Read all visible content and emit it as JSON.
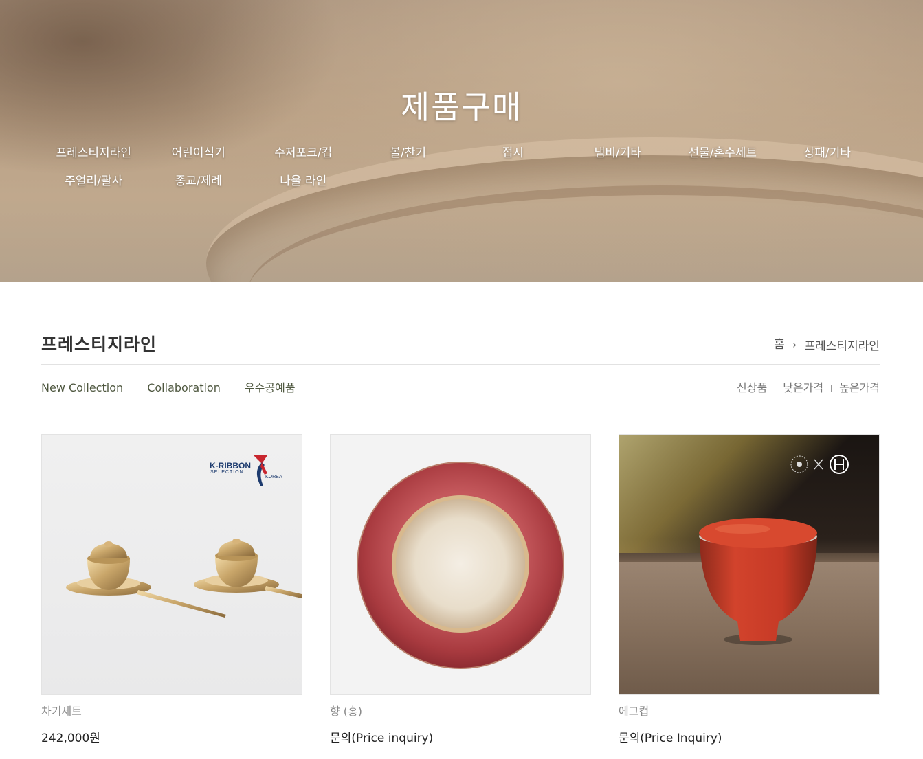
{
  "hero": {
    "title": "제품구매",
    "categories": [
      "프레스티지라인",
      "어린이식기",
      "수저포크/컵",
      "볼/찬기",
      "접시",
      "냄비/기타",
      "선물/혼수세트",
      "상패/기타",
      "주얼리/괄사",
      "종교/제례",
      "나울 라인"
    ]
  },
  "section": {
    "title": "프레스티지라인",
    "breadcrumb": {
      "home": "홈",
      "separator": "›",
      "current": "프레스티지라인"
    }
  },
  "sub_nav": [
    "New Collection",
    "Collaboration",
    "우수공예품"
  ],
  "sort": [
    "신상품",
    "낮은가격",
    "높은가격"
  ],
  "products": [
    {
      "name": "차기세트",
      "price": "242,000원",
      "badge": {
        "line1": "K-RIBBON",
        "line2": "SELECTION",
        "line3": "KOREA"
      }
    },
    {
      "name": "향 (홍)",
      "price": "문의(Price inquiry)"
    },
    {
      "name": "에그컵",
      "price": "문의(Price Inquiry)"
    }
  ],
  "colors": {
    "accent_text": "#4f5840",
    "ribbon_red": "#c8262e",
    "ribbon_blue": "#1d3b6e",
    "plate_red": "#a83a3f",
    "cup_red": "#d2432c"
  }
}
